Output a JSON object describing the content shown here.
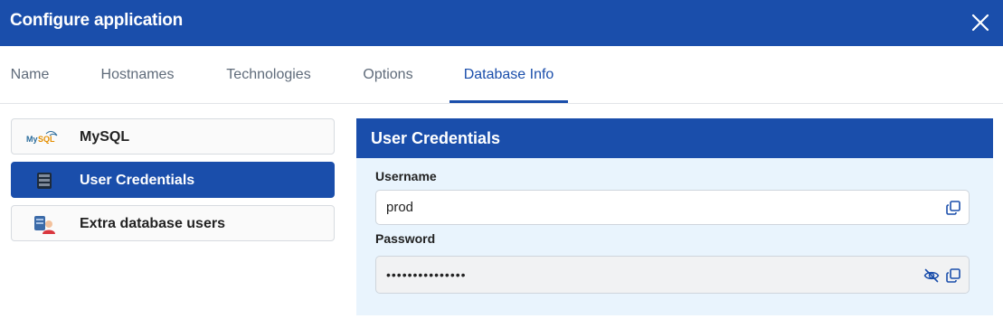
{
  "window": {
    "title": "Configure application",
    "close_icon": "close-icon"
  },
  "tabs": [
    {
      "label": "Name",
      "active": false
    },
    {
      "label": "Hostnames",
      "active": false
    },
    {
      "label": "Technologies",
      "active": false
    },
    {
      "label": "Options",
      "active": false
    },
    {
      "label": "Database Info",
      "active": true
    }
  ],
  "sidebar": {
    "items": [
      {
        "label": "MySQL",
        "icon": "mysql-logo-icon",
        "active": false
      },
      {
        "label": "User Credentials",
        "icon": "database-server-icon",
        "active": true
      },
      {
        "label": "Extra database users",
        "icon": "database-user-icon",
        "active": false
      }
    ]
  },
  "credentials": {
    "title": "User Credentials",
    "username_label": "Username",
    "username_value": "prod",
    "password_label": "Password",
    "password_value": "•••••••••••••••",
    "copy_icon": "copy-icon",
    "visibility_icon": "eye-off-icon"
  },
  "colors": {
    "accent": "#1a4eab",
    "panel_bg": "#e9f4fd",
    "tab_inactive": "#5f6b7a"
  }
}
